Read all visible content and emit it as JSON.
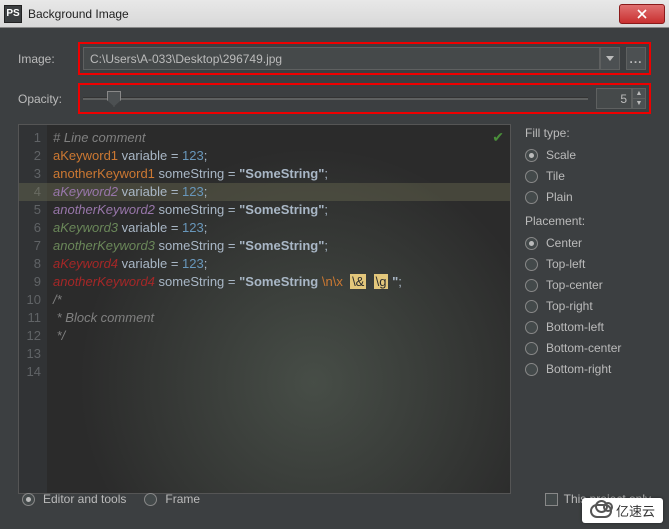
{
  "window": {
    "title": "Background Image",
    "icon_label": "PS"
  },
  "image_row": {
    "label": "Image:",
    "path": "C:\\Users\\A-033\\Desktop\\296749.jpg",
    "browse_glyph": "..."
  },
  "opacity_row": {
    "label": "Opacity:",
    "value": "5"
  },
  "code_lines": [
    "# Line comment",
    "aKeyword1 variable = 123;",
    "anotherKeyword1 someString = \"SomeString\";",
    "aKeyword2 variable = 123;",
    "anotherKeyword2 someString = \"SomeString\";",
    "aKeyword3 variable = 123;",
    "anotherKeyword3 someString = \"SomeString\";",
    "aKeyword4 variable = 123;",
    "anotherKeyword4 someString = \"SomeString \\n\\x  \\&  \\g \";",
    "/*",
    " * Block comment",
    " */",
    "",
    ""
  ],
  "fill": {
    "heading": "Fill type:",
    "options": [
      "Scale",
      "Tile",
      "Plain"
    ],
    "selected": "Scale"
  },
  "placement": {
    "heading": "Placement:",
    "options": [
      "Center",
      "Top-left",
      "Top-center",
      "Top-right",
      "Bottom-left",
      "Bottom-center",
      "Bottom-right"
    ],
    "selected": "Center"
  },
  "bottom": {
    "show_in": {
      "options": [
        "Editor and tools",
        "Frame"
      ],
      "selected": "Editor and tools"
    },
    "project_only": "This project only"
  },
  "watermark": "亿速云"
}
